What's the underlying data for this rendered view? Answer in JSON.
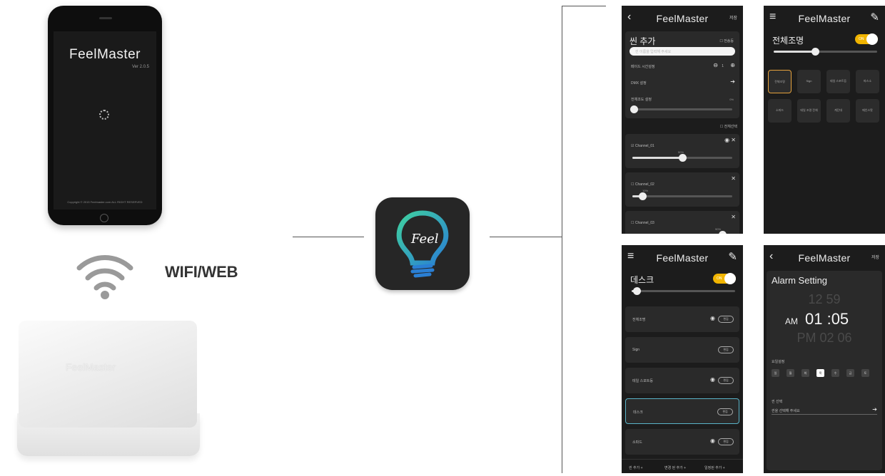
{
  "phone": {
    "app_name": "FeelMaster",
    "version": "Ver 2.0.5",
    "copyright": "Copyright © 2015 Feelmaster.com ALL RIGHT RESERVED"
  },
  "wifi_label": "WIFI/WEB",
  "hub_brand": "FeelMaster",
  "app_icon_text": "Feel",
  "screen1": {
    "title": "FeelMaster",
    "back": "‹",
    "save": "저장",
    "heading": "씬 추가",
    "all_select": "전송등",
    "name_placeholder": "씬 이름을 입력해 주세요",
    "fade_label": "페이드 시간설정",
    "fade_value": "1",
    "dmx_label": "DMX 설정",
    "brightness_label": "전체조도 설정",
    "brightness_pct": "0%",
    "select_all": "전체선택",
    "channels": [
      {
        "name": "Channel_01",
        "pct": "50%",
        "checked": true,
        "level": 0.5
      },
      {
        "name": "Channel_02",
        "pct": "10%",
        "checked": false,
        "level": 0.1
      },
      {
        "name": "Channel_03",
        "pct": "90%",
        "checked": false,
        "level": 0.9
      }
    ]
  },
  "screen2": {
    "title": "FeelMaster",
    "menu": "≡",
    "edit": "✎",
    "heading": "전체조명",
    "toggle": "ON",
    "level": 0.4,
    "tiles": [
      "전체조명",
      "Sign",
      "테일 스포트등",
      "파스소",
      "소파드",
      "테일 조명 전체",
      "계단대",
      "메인스팟"
    ]
  },
  "screen3": {
    "title": "FeelMaster",
    "menu": "≡",
    "edit": "✎",
    "heading": "데스크",
    "toggle": "ON",
    "level": 0.05,
    "rows": [
      {
        "name": "전체조명",
        "btn": "편집",
        "eye": true,
        "sel": false
      },
      {
        "name": "Sign",
        "btn": "편집",
        "eye": false,
        "sel": false
      },
      {
        "name": "테일 스포트등",
        "btn": "편집",
        "eye": true,
        "sel": false
      },
      {
        "name": "데스크",
        "btn": "편집",
        "eye": false,
        "sel": true
      },
      {
        "name": "소파드",
        "btn": "편집",
        "eye": true,
        "sel": false
      }
    ],
    "footer": [
      "씬 추가 +",
      "변경 된 추가 +",
      "일정된 추가 +"
    ]
  },
  "screen4": {
    "title": "FeelMaster",
    "back": "‹",
    "save": "저장",
    "heading": "Alarm Setting",
    "time_prev": "12 59",
    "ampm": "AM",
    "time_now": "01 :05",
    "time_next": "PM 02 06",
    "weekday_label": "요일설정",
    "days": [
      "일",
      "월",
      "화",
      "목",
      "수",
      "금",
      "토"
    ],
    "day_on_index": 3,
    "scene_label": "씬 선택",
    "scene_placeholder": "씬을 선택해 주세요"
  }
}
